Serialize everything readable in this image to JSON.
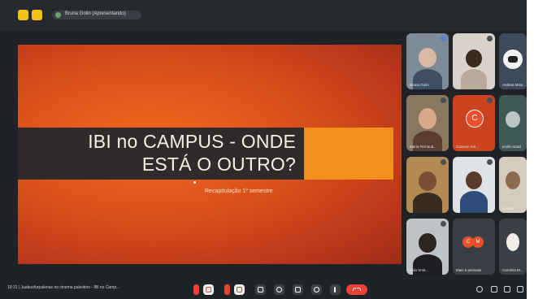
{
  "topbar": {
    "presenter": "Bruna Golin (Apresentando)"
  },
  "slide": {
    "title_line1": "IBI no CAMPUS - ONDE",
    "title_line2": "ESTÁ O OUTRO?",
    "subtitle": "Recapitulação 1º semestre"
  },
  "participants": {
    "tiles": [
      {
        "name": "Bruna Golin"
      },
      {
        "name": ""
      },
      {
        "name": "Andrea Mosi..."
      },
      {
        "name": "Maria Fernand..."
      },
      {
        "name": "Caiusen Am..."
      },
      {
        "name": "ecelin ssacl"
      },
      {
        "name": ""
      },
      {
        "name": ""
      },
      {
        "name": "Natalia"
      },
      {
        "name": "Bulo Smit..."
      },
      {
        "name": "Mais 6 pessoas"
      },
      {
        "name": "Carolina M..."
      }
    ],
    "c_initial": "C",
    "more_initials": [
      "C",
      "M"
    ]
  },
  "bottombar": {
    "meeting_info": "19:31 | Juabusfurpalenas no cinema palestino - IBI no Camp..."
  },
  "colors": {
    "slide_orange": "#e25a1c",
    "title_dark": "#2e2b2a",
    "accent_orange": "#f3901d",
    "end_call_red": "#ea4335",
    "window_yellow": "#f2c21b"
  },
  "icons": [
    "microphone-off-icon",
    "camera-off-icon",
    "captions-icon",
    "emoji-icon",
    "present-icon",
    "raise-hand-icon",
    "more-options-icon",
    "end-call-icon",
    "info-icon",
    "people-icon",
    "chat-icon",
    "activities-icon"
  ]
}
